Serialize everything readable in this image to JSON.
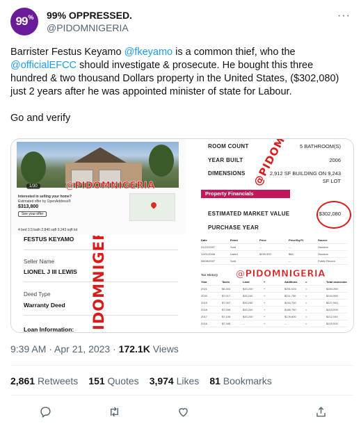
{
  "author": {
    "avatar_text": "99",
    "avatar_sup": "%",
    "display_name": "99% OPPRESSED.",
    "handle": "@PIDOMNIGERIA"
  },
  "more_icon": "more-icon",
  "tweet": {
    "text_part1": "Barrister Festus Keyamo ",
    "mention1": "@fkeyamo",
    "text_part2": " is a common thief, who the ",
    "mention2": "@officialEFCC",
    "text_part3": " should investigate & prosecute. He bought this three hundred & two thousand Dollars property in the United States, ($302,080) just 2 years after he was appointed minister of state for Labour.",
    "text_part4": "Go and verify"
  },
  "media": {
    "watermark": "@PIDOMNIGERIA",
    "watermark_vertical": "IDOMNIGER",
    "listing": {
      "photo_count": "1/30",
      "interested": "Interested in selling your home?",
      "offer": "Estimated offer by OpenAddress®",
      "price": "$313,800",
      "button": "See your offer",
      "stats": "4 bed  3.5 bath  2,840 sqft  9,243 sqft lot"
    },
    "property": {
      "room_count_label": "ROOM COUNT",
      "room_count_value": "5 BATHROOM(S)",
      "year_built_label": "YEAR BUILT",
      "year_built_value": "2006",
      "dimensions_label": "DIMENSIONS",
      "dimensions_value_1": "2,912 SF BUILDING ON 9,243",
      "dimensions_value_2": "SF LOT",
      "financials_bar": "Property Financials",
      "market_value_label": "ESTIMATED MARKET VALUE",
      "market_value": "$302,080",
      "purchase_year_label": "PURCHASE YEAR"
    },
    "deed": {
      "owner": "FESTUS KEYAMO",
      "seller_name_label": "Seller Name",
      "seller_name": "LIONEL J III LEWIS",
      "deed_type_label": "Deed Type",
      "deed_type": "Warranty Deed",
      "loan_info": "Loan Information:"
    },
    "history": {
      "columns": [
        "Date",
        "Event",
        "Price",
        "Price/Sq Ft",
        "Source"
      ],
      "rows": [
        [
          "01/22/2007",
          "Sold",
          "--",
          "--",
          "Houston"
        ],
        [
          "12/01/2006",
          "Listed",
          "$299,900",
          "$84",
          "Houston"
        ],
        [
          "08/08/2007",
          "Sold",
          "--",
          "--",
          "Public Record"
        ]
      ],
      "tax_title": "Tax History",
      "tax_columns": [
        "Year",
        "Taxes",
        "Land",
        "+",
        "Additions",
        "=",
        "Total assessments"
      ],
      "tax_rows": [
        [
          "2021",
          "$6,404",
          "$33,240",
          "+",
          "$251,025",
          "=",
          "$284,265"
        ],
        [
          "2020",
          "$7,017",
          "$33,240",
          "+",
          "$211,750",
          "=",
          "$244,990"
        ],
        [
          "2019",
          "$7,007",
          "$33,240",
          "+",
          "$194,700",
          "=",
          "$227,940"
        ],
        [
          "2018",
          "$7,006",
          "$33,240",
          "+",
          "$185,760",
          "=",
          "$219,000"
        ],
        [
          "2017",
          "$7,106",
          "$33,240",
          "+",
          "$178,800",
          "=",
          "$212,040"
        ],
        [
          "2016",
          "$7,345",
          "--",
          "+",
          "--",
          "=",
          "$215,000"
        ]
      ]
    }
  },
  "meta": {
    "time": "9:39 AM",
    "separator": " · ",
    "date": "Apr 21, 2023",
    "views_count": "172.1K",
    "views_label": " Views"
  },
  "stats": {
    "retweets_count": "2,861",
    "retweets_label": "Retweets",
    "quotes_count": "151",
    "quotes_label": "Quotes",
    "likes_count": "3,974",
    "likes_label": "Likes",
    "bookmarks_count": "81",
    "bookmarks_label": "Bookmarks"
  },
  "actions": [
    "reply-icon",
    "retweet-icon",
    "like-icon",
    "share-icon"
  ],
  "colors": {
    "link": "#1d9bf0",
    "text": "#0f1419",
    "muted": "#536471",
    "watermark": "#d81b1b",
    "financials_bar": "#c2185b"
  }
}
